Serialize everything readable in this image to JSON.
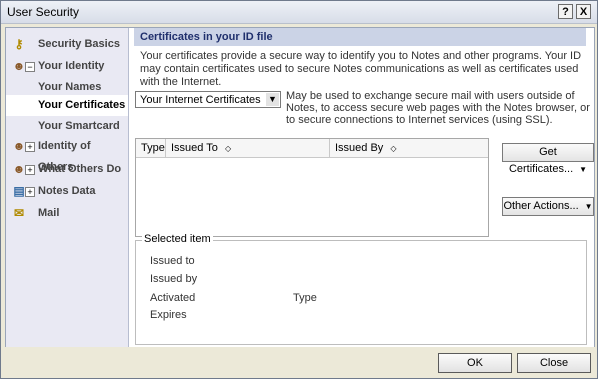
{
  "window": {
    "title": "User Security",
    "help_label": "?",
    "close_label": "X"
  },
  "sidebar": {
    "items": [
      {
        "label": "Security Basics",
        "icon": "key-icon"
      },
      {
        "label": "Your Identity",
        "icon": "person-icon",
        "expander": "−"
      },
      {
        "label": "Your Names"
      },
      {
        "label": "Your Certificates"
      },
      {
        "label": "Your Smartcard"
      },
      {
        "label": "Identity of Others",
        "icon": "people-icon",
        "expander": "+"
      },
      {
        "label": "What Others Do",
        "icon": "group-icon",
        "expander": "+"
      },
      {
        "label": "Notes Data",
        "icon": "notes-data-icon",
        "expander": "+"
      },
      {
        "label": "Mail",
        "icon": "mail-icon"
      }
    ]
  },
  "main": {
    "header": "Certificates in your ID file",
    "description": "Your certificates provide a secure way to identify you to Notes and other programs. Your ID may contain certificates used to secure Notes communications as well as certificates used with the Internet.",
    "cert_type_selected": "Your Internet Certificates",
    "cert_type_description": "May be used to exchange secure mail with users outside of Notes, to access secure web pages with the Notes browser, or to secure connections to Internet services (using SSL).",
    "table": {
      "columns": [
        "Type",
        "Issued To",
        "Issued By"
      ]
    },
    "get_certificates_label": "Get Certificates...",
    "other_actions_label": "Other Actions...",
    "selected_item": {
      "legend": "Selected item",
      "issued_to_label": "Issued to",
      "issued_by_label": "Issued by",
      "activated_label": "Activated",
      "type_label": "Type",
      "expires_label": "Expires"
    }
  },
  "buttons": {
    "ok": "OK",
    "close": "Close"
  },
  "colors": {
    "header_bg": "#cbd3e6",
    "sidebar_bg": "#e9e9f3",
    "window_bg": "#ece9d8"
  }
}
